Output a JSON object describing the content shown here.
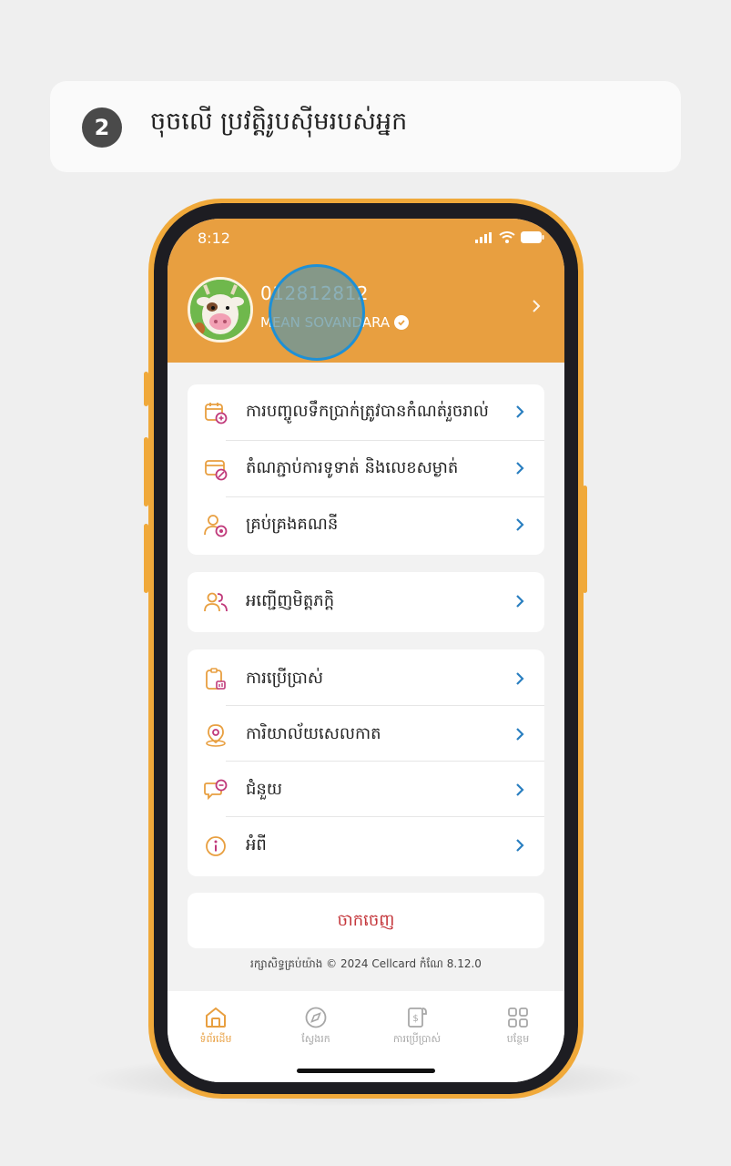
{
  "step": {
    "number": "2",
    "instruction": "ចុចលើ ប្រវត្តិរូបស៊ីមរបស់អ្នក"
  },
  "status_bar": {
    "time": "8:12",
    "icons": [
      "signal-icon",
      "wifi-icon",
      "battery-icon"
    ]
  },
  "profile": {
    "phone_number": "012812812",
    "name": "MEAN SOVANDARA",
    "verified_icon": "check-circle-icon"
  },
  "menu_groups": [
    {
      "items": [
        {
          "label": "ការបញ្ចូលទឹកប្រាក់ត្រូវបានកំណត់រួចរាល់",
          "icon": "calendar-plus-icon"
        },
        {
          "label": "តំណភ្ជាប់ការទូទាត់ និងលេខសម្ងាត់",
          "icon": "card-settings-icon"
        },
        {
          "label": "គ្រប់គ្រងគណនី",
          "icon": "user-settings-icon"
        }
      ]
    },
    {
      "items": [
        {
          "label": "អញ្ជើញមិត្តភក្តិ",
          "icon": "invite-friends-icon"
        }
      ]
    },
    {
      "items": [
        {
          "label": "ការប្រើប្រាស់",
          "icon": "usage-icon"
        },
        {
          "label": "ការិយាល័យសេលកាត",
          "icon": "location-pin-icon"
        },
        {
          "label": "ជំនួយ",
          "icon": "help-chat-icon"
        },
        {
          "label": "អំពី",
          "icon": "info-icon"
        }
      ]
    }
  ],
  "logout": {
    "label": "ចាកចេញ"
  },
  "copyright": "រក្សាសិទ្ធគ្រប់យ៉ាង © 2024 Cellcard កំណែ 8.12.0",
  "tabs": [
    {
      "label": "ទំព័រដើម",
      "icon": "home-icon",
      "active": true
    },
    {
      "label": "ស្វែងរក",
      "icon": "compass-icon",
      "active": false
    },
    {
      "label": "ការប្រើប្រាស់",
      "icon": "receipt-icon",
      "active": false
    },
    {
      "label": "បន្ថែម",
      "icon": "grid-icon",
      "active": false
    }
  ],
  "colors": {
    "accent": "#e89f40",
    "icon_pink": "#c0397a",
    "chevron": "#2a7fc0",
    "logout": "#c4353a"
  }
}
